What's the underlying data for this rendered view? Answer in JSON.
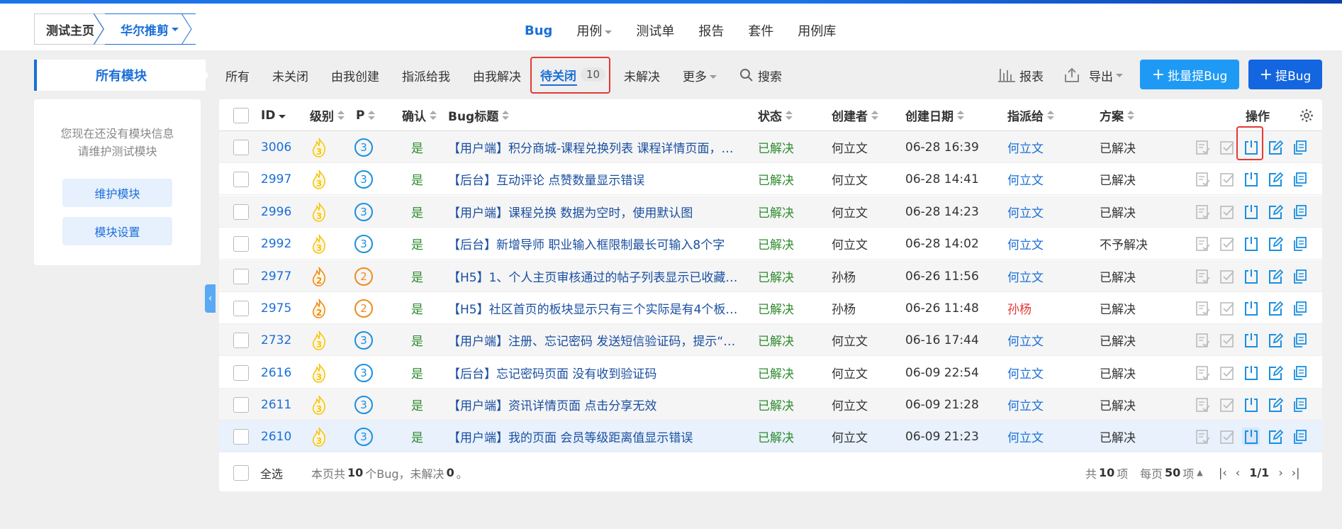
{
  "breadcrumb": {
    "home": "测试主页",
    "product": "华尔推剪"
  },
  "main_nav": [
    "Bug",
    "用例",
    "测试单",
    "报告",
    "套件",
    "用例库"
  ],
  "sidebar": {
    "title": "所有模块",
    "empty_line1": "您现在还没有模块信息",
    "empty_line2": "请维护测试模块",
    "btn_maintain": "维护模块",
    "btn_settings": "模块设置"
  },
  "filter_tabs": [
    "所有",
    "未关闭",
    "由我创建",
    "指派给我",
    "由我解决"
  ],
  "active_tab": {
    "label": "待关闭",
    "count": "10"
  },
  "filter_tabs_after": [
    "未解决",
    "更多"
  ],
  "search_label": "搜索",
  "tools": {
    "report": "报表",
    "export": "导出",
    "batch_btn": "批量提Bug",
    "add_btn": "提Bug"
  },
  "columns": {
    "id": "ID",
    "severity": "级别",
    "pri": "P",
    "confirmed": "确认",
    "title": "Bug标题",
    "status": "状态",
    "creator": "创建者",
    "date": "创建日期",
    "assignee": "指派给",
    "resolution": "方案",
    "actions": "操作"
  },
  "rows": [
    {
      "id": "3006",
      "sev": "3",
      "pri": "3",
      "confirmed": "是",
      "title": "【用户端】积分商城-课程兑换列表 课程详情页面，…",
      "status": "已解决",
      "creator": "何立文",
      "date": "06-28 16:39",
      "assignee": "何立文",
      "resolution": "已解决"
    },
    {
      "id": "2997",
      "sev": "3",
      "pri": "3",
      "confirmed": "是",
      "title": "【后台】互动评论 点赞数量显示错误",
      "status": "已解决",
      "creator": "何立文",
      "date": "06-28 14:41",
      "assignee": "何立文",
      "resolution": "已解决"
    },
    {
      "id": "2996",
      "sev": "3",
      "pri": "3",
      "confirmed": "是",
      "title": "【用户端】课程兑换 数据为空时，使用默认图",
      "status": "已解决",
      "creator": "何立文",
      "date": "06-28 14:23",
      "assignee": "何立文",
      "resolution": "已解决"
    },
    {
      "id": "2992",
      "sev": "3",
      "pri": "3",
      "confirmed": "是",
      "title": "【后台】新增导师 职业输入框限制最长可输入8个字",
      "status": "已解决",
      "creator": "何立文",
      "date": "06-28 14:02",
      "assignee": "何立文",
      "resolution": "不予解决"
    },
    {
      "id": "2977",
      "sev": "2",
      "pri": "2",
      "confirmed": "是",
      "title": "【H5】1、个人主页审核通过的帖子列表显示已收藏…",
      "status": "已解决",
      "creator": "孙杨",
      "date": "06-26 11:56",
      "assignee": "何立文",
      "resolution": "已解决"
    },
    {
      "id": "2975",
      "sev": "2",
      "pri": "2",
      "confirmed": "是",
      "title": "【H5】社区首页的板块显示只有三个实际是有4个板…",
      "status": "已解决",
      "creator": "孙杨",
      "date": "06-26 11:48",
      "assignee": "孙杨",
      "resolution": "已解决"
    },
    {
      "id": "2732",
      "sev": "3",
      "pri": "3",
      "confirmed": "是",
      "title": "【用户端】注册、忘记密码 发送短信验证码，提示“…",
      "status": "已解决",
      "creator": "何立文",
      "date": "06-16 17:44",
      "assignee": "何立文",
      "resolution": "已解决"
    },
    {
      "id": "2616",
      "sev": "3",
      "pri": "3",
      "confirmed": "是",
      "title": "【后台】忘记密码页面 没有收到验证码",
      "status": "已解决",
      "creator": "何立文",
      "date": "06-09 22:54",
      "assignee": "何立文",
      "resolution": "已解决"
    },
    {
      "id": "2611",
      "sev": "3",
      "pri": "3",
      "confirmed": "是",
      "title": "【用户端】资讯详情页面 点击分享无效",
      "status": "已解决",
      "creator": "何立文",
      "date": "06-09 21:28",
      "assignee": "何立文",
      "resolution": "已解决"
    },
    {
      "id": "2610",
      "sev": "3",
      "pri": "3",
      "confirmed": "是",
      "title": "【用户端】我的页面 会员等级距离值显示错误",
      "status": "已解决",
      "creator": "何立文",
      "date": "06-09 21:23",
      "assignee": "何立文",
      "resolution": "已解决"
    }
  ],
  "footer": {
    "select_all": "全选",
    "summary_prefix": "本页共",
    "summary_count": "10",
    "summary_mid": "个Bug，未解决",
    "summary_unresolved": "0",
    "summary_suffix": "。",
    "total_prefix": "共",
    "total_count": "10",
    "total_suffix": "项",
    "per_page_prefix": "每页",
    "per_page": "50",
    "per_page_suffix": "项",
    "page": "1/1"
  },
  "colors": {
    "accent": "#1a6fd8",
    "resolved": "#2e8b2e",
    "highlight": "#e53935",
    "batch_btn": "#1e9af5",
    "add_btn": "#1366e0"
  }
}
